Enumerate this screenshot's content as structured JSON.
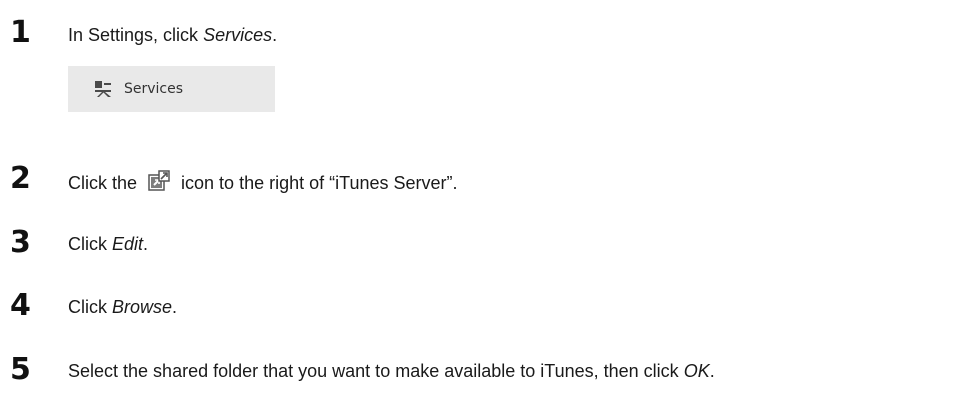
{
  "steps": [
    {
      "number": "1",
      "pre": "In Settings, click ",
      "em": "Services",
      "post": "."
    },
    {
      "number": "2",
      "pre": "Click the ",
      "post": " icon to the right of “iTunes Server”."
    },
    {
      "number": "3",
      "pre": "Click ",
      "em": "Edit",
      "post": "."
    },
    {
      "number": "4",
      "pre": "Click ",
      "em": "Browse",
      "post": "."
    },
    {
      "number": "5",
      "pre": "Select the shared folder that you want to make available to iTunes, then click ",
      "em": "OK",
      "post": "."
    }
  ],
  "services_button": {
    "label": "Services",
    "icon": "services-icon"
  },
  "settings_icon": "open-settings-icon"
}
